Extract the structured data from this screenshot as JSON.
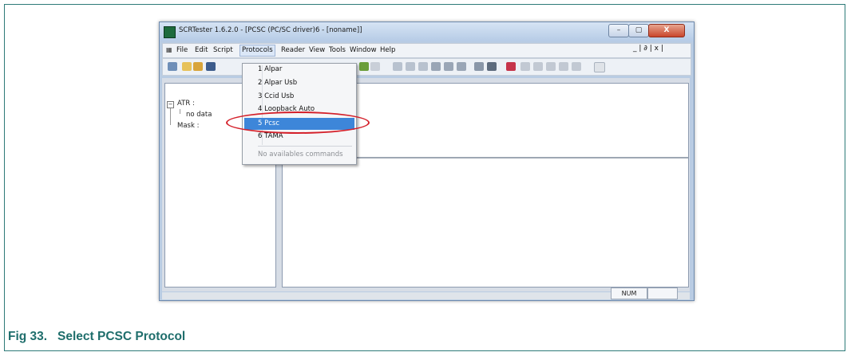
{
  "window": {
    "title": "SCRTester 1.6.2.0 - [PCSC (PC/SC driver)6 - [noname]]",
    "min": "–",
    "max": "▢",
    "close": "X"
  },
  "menubar": {
    "items": [
      "File",
      "Edit",
      "Script",
      "Protocols",
      "Reader",
      "View",
      "Tools",
      "Window",
      "Help"
    ],
    "child_controls": "_  |  ∂  |  x |"
  },
  "tree": {
    "expander": "−",
    "atr": "ATR :",
    "no_data": "no data",
    "mask": "Mask :"
  },
  "dropdown": {
    "items": [
      "1 Alpar",
      "2 Alpar Usb",
      "3 Ccid Usb",
      "4 Loopback Auto",
      "5 Pcsc",
      "6 TAMA"
    ],
    "selected_index": 4,
    "disabled_item": "No availables commands"
  },
  "statusbar": {
    "num": "NUM"
  },
  "caption": "Fig 33.   Select PCSC Protocol",
  "colors": {
    "accent": "#1f6e6c",
    "highlight": "#3d86d9",
    "annotation_red": "#d4202a"
  }
}
